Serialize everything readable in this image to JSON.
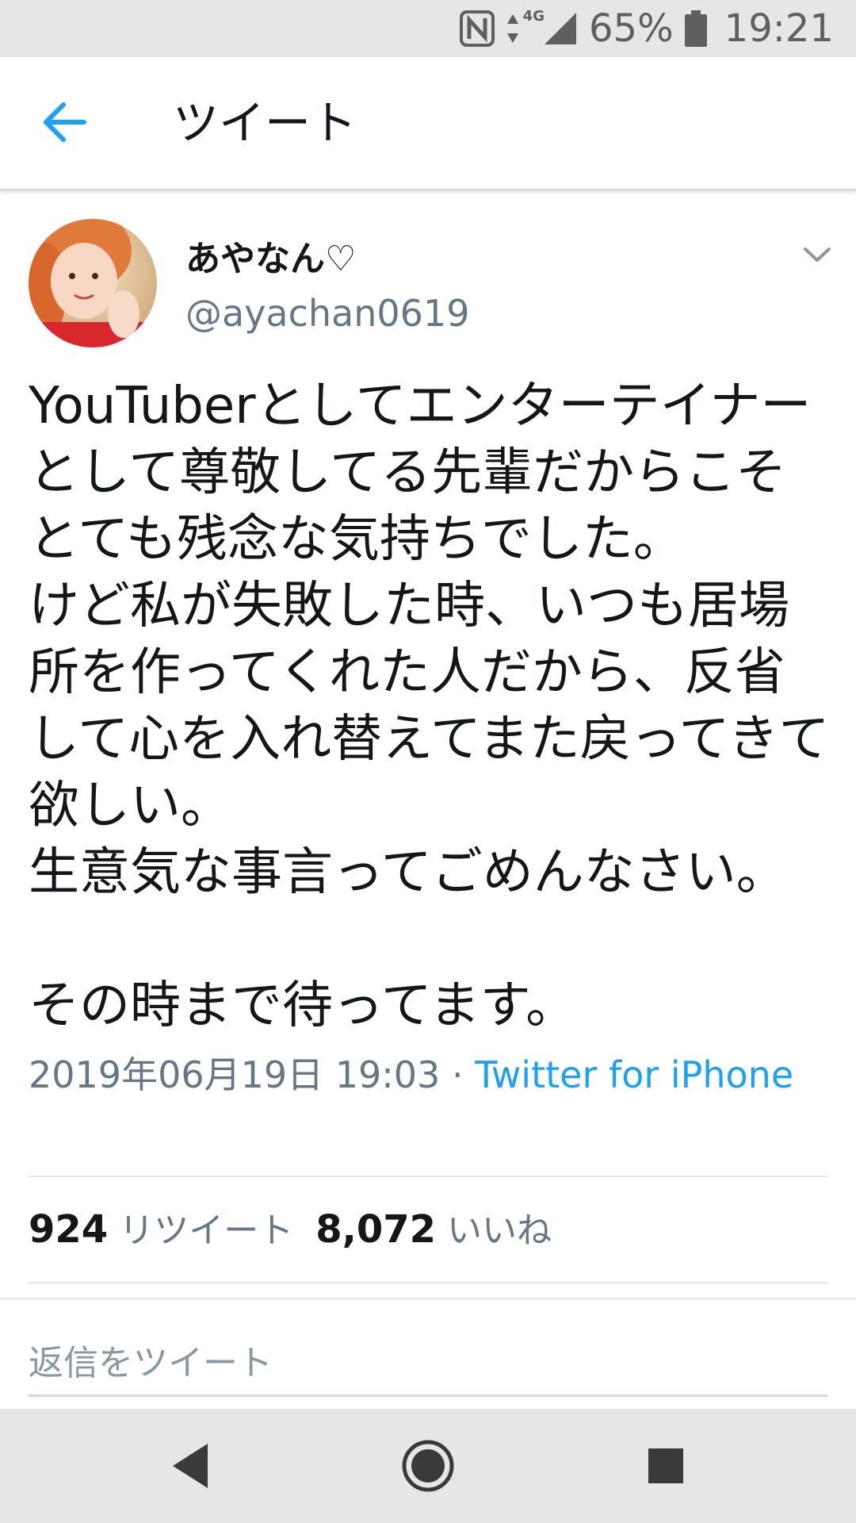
{
  "status_bar": {
    "battery": "65%",
    "time": "19:21",
    "network": "4G",
    "icons": [
      "nfc-icon",
      "data-arrows-icon",
      "signal-icon",
      "battery-icon"
    ]
  },
  "app_bar": {
    "back_icon": "arrow-left-icon",
    "title": "ツイート"
  },
  "tweet": {
    "display_name": "あやなん♡",
    "handle": "@ayachan0619",
    "text": "YouTuberとしてエンターテイナーとして尊敬してる先輩だからこそとても残念な気持ちでした。\nけど私が失敗した時、いつも居場所を作ってくれた人だから、反省して心を入れ替えてまた戻ってきて欲しい。\n生意気な事言ってごめんなさい。\n\nその時まで待ってます。",
    "timestamp": "2019年06月19日 19:03",
    "separator": " · ",
    "source": "Twitter for iPhone",
    "retweets_count": "924",
    "retweets_label": "リツイート",
    "likes_count": "8,072",
    "likes_label": "いいね"
  },
  "reply": {
    "placeholder": "返信をツイート"
  },
  "colors": {
    "accent": "#1da1f2",
    "secondary_text": "#657786",
    "primary_text": "#14171a"
  },
  "nav_bar": {
    "icons": [
      "nav-back-icon",
      "nav-home-icon",
      "nav-recents-icon"
    ]
  }
}
